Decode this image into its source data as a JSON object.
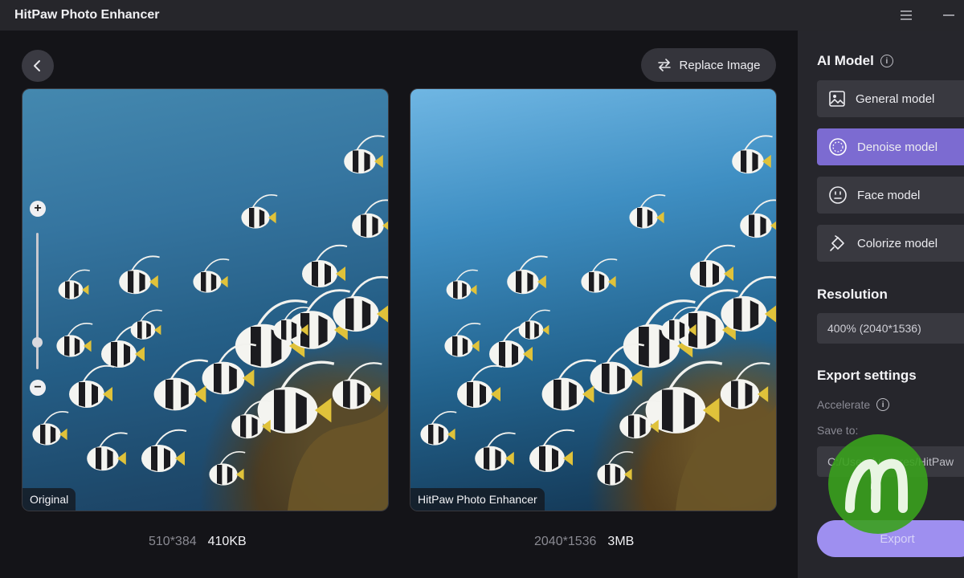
{
  "app": {
    "title": "HitPaw Photo Enhancer"
  },
  "toolbar": {
    "replace_label": "Replace Image"
  },
  "panels": {
    "left": {
      "label": "Original",
      "dimensions": "510*384",
      "size": "410KB"
    },
    "right": {
      "label": "HitPaw Photo Enhancer",
      "dimensions": "2040*1536",
      "size": "3MB"
    }
  },
  "sidebar": {
    "ai_model_title": "AI Model",
    "models": [
      {
        "label": "General model",
        "icon": "image-icon",
        "active": false
      },
      {
        "label": "Denoise model",
        "icon": "denoise-icon",
        "active": true
      },
      {
        "label": "Face model",
        "icon": "face-icon",
        "active": false
      },
      {
        "label": "Colorize model",
        "icon": "paint-bucket-icon",
        "active": false
      }
    ],
    "resolution_title": "Resolution",
    "resolution_value": "400% (2040*1536)",
    "export_title": "Export settings",
    "accelerate_label": "Accelerate",
    "save_to_label": "Save to:",
    "save_path": "C:/Users/u...tures/HitPaw",
    "export_label": "Export"
  },
  "colors": {
    "accent": "#7c6bd1",
    "export": "#9e8ff0",
    "sidebar_bg": "#26262c"
  }
}
